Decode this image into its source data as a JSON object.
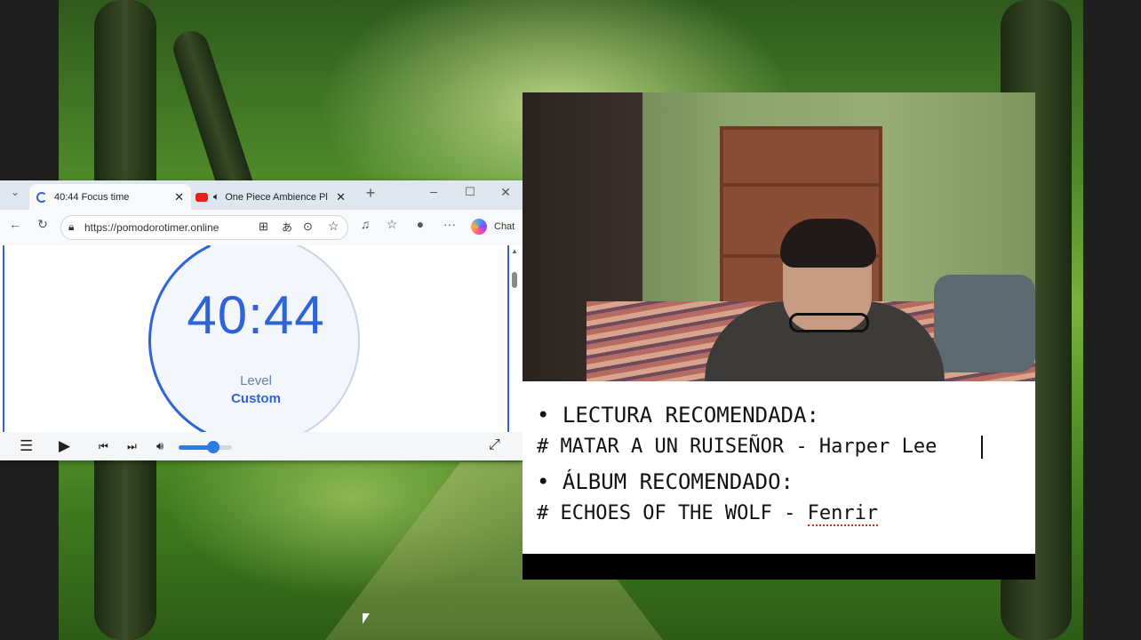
{
  "browser": {
    "tabs": [
      {
        "label": "40:44 Focus time",
        "active": true
      },
      {
        "label": "One Piece Ambience Pl",
        "active": false
      }
    ],
    "url": "https://pomodorotimer.online",
    "chat_label": "Chat"
  },
  "timer": {
    "time": "40:44",
    "level_label": "Level",
    "level_value": "Custom",
    "accent_color": "#2f64d8"
  },
  "player": {
    "volume_fraction": 0.65
  },
  "overlay_text": {
    "line1": "LECTURA RECOMENDADA:",
    "line2": "# MATAR A UN RUISEÑOR - Harper Lee",
    "line3": "ÁLBUM RECOMENDADO:",
    "line4_prefix": "# ECHOES OF THE WOLF - ",
    "line4_artist": "Fenrir"
  }
}
